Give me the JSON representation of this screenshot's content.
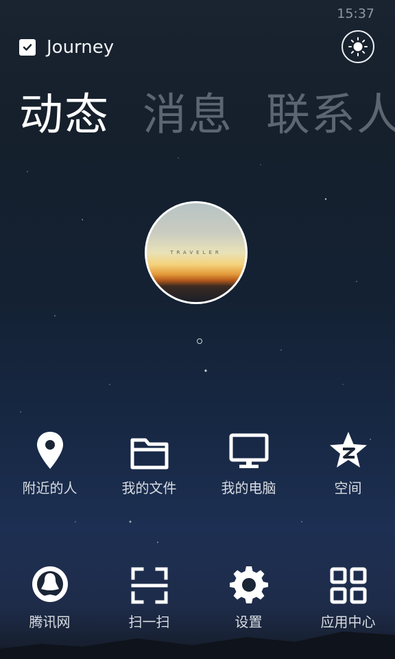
{
  "status_bar": {
    "time": "15:37"
  },
  "header": {
    "app_name": "Journey",
    "check_icon": "checkbox-checked-icon",
    "theme_icon": "sun-icon"
  },
  "tabs": [
    {
      "label": "动态",
      "active": true
    },
    {
      "label": "消息",
      "active": false
    },
    {
      "label": "联系人",
      "active": false
    }
  ],
  "profile": {
    "avatar_caption": "TRAVELER",
    "page_indicator": "1"
  },
  "grid_row_1": [
    {
      "label": "附近的人",
      "icon": "location-pin-icon"
    },
    {
      "label": "我的文件",
      "icon": "folder-icon"
    },
    {
      "label": "我的电脑",
      "icon": "monitor-icon"
    },
    {
      "label": "空间",
      "icon": "qzone-star-icon"
    }
  ],
  "grid_row_2": [
    {
      "label": "腾讯网",
      "icon": "tencent-news-icon"
    },
    {
      "label": "扫一扫",
      "icon": "scan-icon"
    },
    {
      "label": "设置",
      "icon": "gear-icon"
    },
    {
      "label": "应用中心",
      "icon": "app-grid-icon"
    }
  ],
  "colors": {
    "text_active": "#ffffff",
    "text_inactive": "#5c6570",
    "label": "#d8dde2"
  }
}
